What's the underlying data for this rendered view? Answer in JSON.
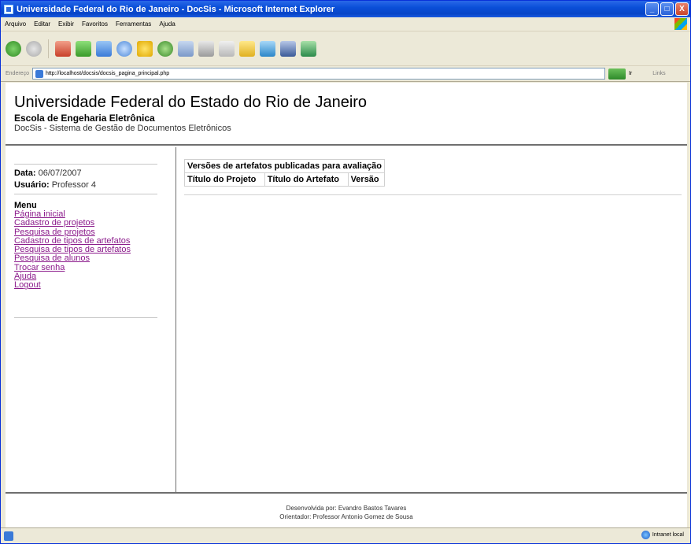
{
  "window": {
    "title": "Universidade Federal do Rio de Janeiro - DocSis - Microsoft Internet Explorer",
    "buttons": {
      "minimize": "_",
      "maximize": "□",
      "close": "X"
    }
  },
  "menubar": [
    "Arquivo",
    "Editar",
    "Exibir",
    "Favoritos",
    "Ferramentas",
    "Ajuda"
  ],
  "address": {
    "label": "Endereço",
    "url": "http://localhost/docsis/docsis_pagina_principal.php",
    "go": "Ir",
    "links": "Links"
  },
  "header": {
    "title": "Universidade Federal do Estado do Rio de Janeiro",
    "school": "Escola de Engeharia Eletrônica",
    "system": "DocSis - Sistema de Gestão de Documentos Eletrônicos"
  },
  "sidebar": {
    "date_label": "Data:",
    "date_value": "06/07/2007",
    "user_label": "Usuário:",
    "user_value": "Professor 4",
    "menu_title": "Menu",
    "links": [
      "Página inicial",
      "Cadastro de projetos",
      "Pesquisa de projetos",
      "Cadastro de tipos de artefatos",
      "Pesquisa de tipos de artefatos",
      "Pesquisa de alunos",
      "Trocar senha",
      "Ajuda",
      "Logout"
    ]
  },
  "main": {
    "table_caption": "Versões de artefatos publicadas para avaliação",
    "columns": [
      "Título do Projeto",
      "Título do Artefato",
      "Versão"
    ]
  },
  "footer": {
    "line1": "Desenvolvida por: Evandro Bastos Tavares",
    "line2": "Orientador: Professor Antonio Gomez de Sousa"
  },
  "statusbar": {
    "zone": "Intranet local"
  },
  "colors": {
    "titlebar": "#0a4fd8",
    "visited_link": "#8b1a8b",
    "divider": "#6f6f6f"
  }
}
